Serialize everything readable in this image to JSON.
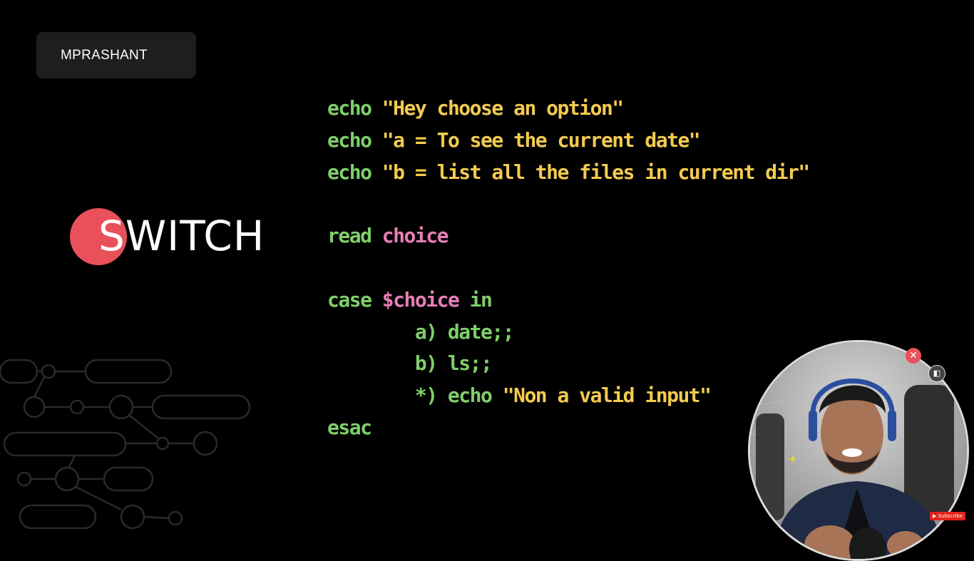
{
  "brand": {
    "name": "MPRASHANT"
  },
  "slide": {
    "title": "SWITCH"
  },
  "code": {
    "l1": {
      "kw": "echo",
      "str": "\"Hey choose an option\""
    },
    "l2": {
      "kw": "echo",
      "str": "\"a = To see the current date\""
    },
    "l3": {
      "kw": "echo",
      "str": "\"b = list all the files in current dir\""
    },
    "l5": {
      "kw": "read",
      "var": "choice"
    },
    "l7": {
      "kw": "case",
      "var": "$choice",
      "kw2": "in"
    },
    "l8": {
      "text": "a) date;;"
    },
    "l9": {
      "text": "b) ls;;"
    },
    "l10": {
      "kw": "*) echo",
      "str": "\"Non a valid input\""
    },
    "l11": {
      "kw": "esac"
    }
  },
  "webcam": {
    "subscribe_label": "Subscribe"
  },
  "colors": {
    "keyword": "#7fcf6a",
    "string": "#f3cb4f",
    "variable": "#e77fb6",
    "accent": "#e8515a",
    "badge": "#1e1e1e"
  },
  "icons": [
    "close-icon",
    "camera-toggle-icon",
    "move-cursor-icon",
    "subscribe-icon"
  ]
}
